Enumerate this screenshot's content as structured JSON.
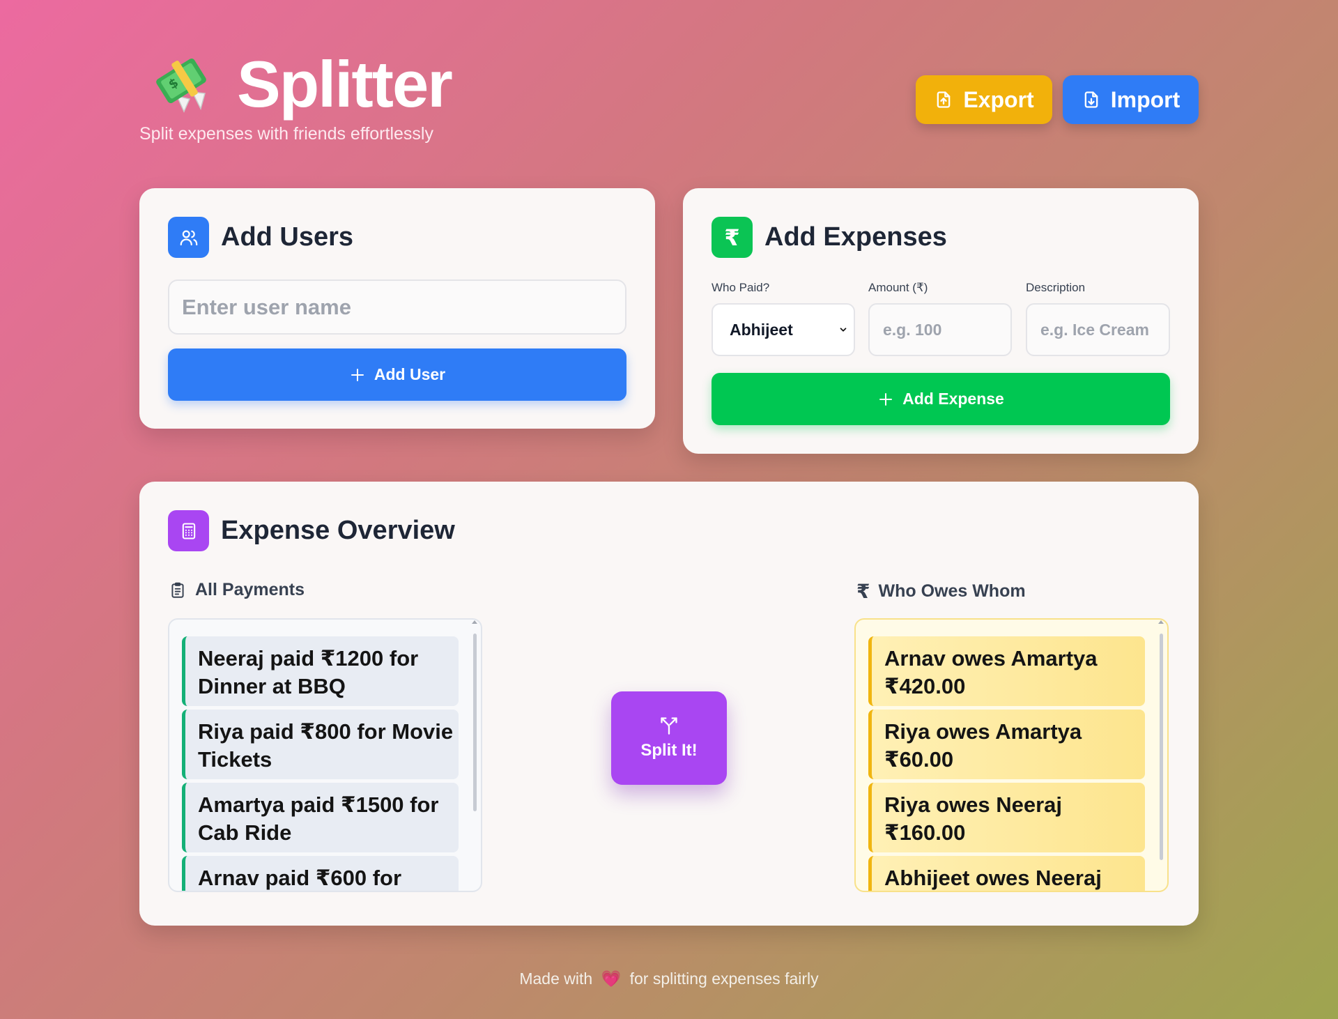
{
  "app": {
    "title": "Splitter",
    "subtitle": "Split expenses with friends effortlessly",
    "logo_icon": "money-with-wings-icon"
  },
  "header": {
    "export_label": "Export",
    "import_label": "Import"
  },
  "users_card": {
    "title": "Add Users",
    "input_placeholder": "Enter user name",
    "input_value": "",
    "add_button_label": "Add User"
  },
  "expenses_card": {
    "title": "Add Expenses",
    "icon_text": "₹",
    "who_paid_label": "Who Paid?",
    "who_paid_selected": "Abhijeet",
    "amount_label": "Amount (₹)",
    "amount_placeholder": "e.g. 100",
    "amount_value": "",
    "description_label": "Description",
    "description_placeholder": "e.g. Ice Cream",
    "description_value": "",
    "add_button_label": "Add Expense"
  },
  "overview": {
    "title": "Expense Overview",
    "payments_heading": "All Payments",
    "owes_heading": "Who Owes Whom",
    "owes_icon_text": "₹",
    "split_button_label": "Split It!",
    "payments": [
      "Neeraj paid ₹1200 for Dinner at BBQ",
      "Riya paid ₹800 for Movie Tickets",
      "Amartya paid ₹1500 for Cab Ride",
      "Arnav paid ₹600 for"
    ],
    "debts": [
      "Arnav owes Amartya ₹420.00",
      "Riya owes Amartya ₹60.00",
      "Riya owes Neeraj ₹160.00",
      "Abhijeet owes Neeraj"
    ]
  },
  "footer": {
    "prefix": "Made with",
    "heart": "💗",
    "suffix": "for splitting expenses fairly"
  },
  "colors": {
    "export": "#f2b10b",
    "import": "#2f7cf6",
    "add_user": "#2f7cf6",
    "add_expense": "#00c752",
    "split": "#a946f2",
    "payment_accent": "#14b077",
    "debt_accent": "#f0b510"
  }
}
